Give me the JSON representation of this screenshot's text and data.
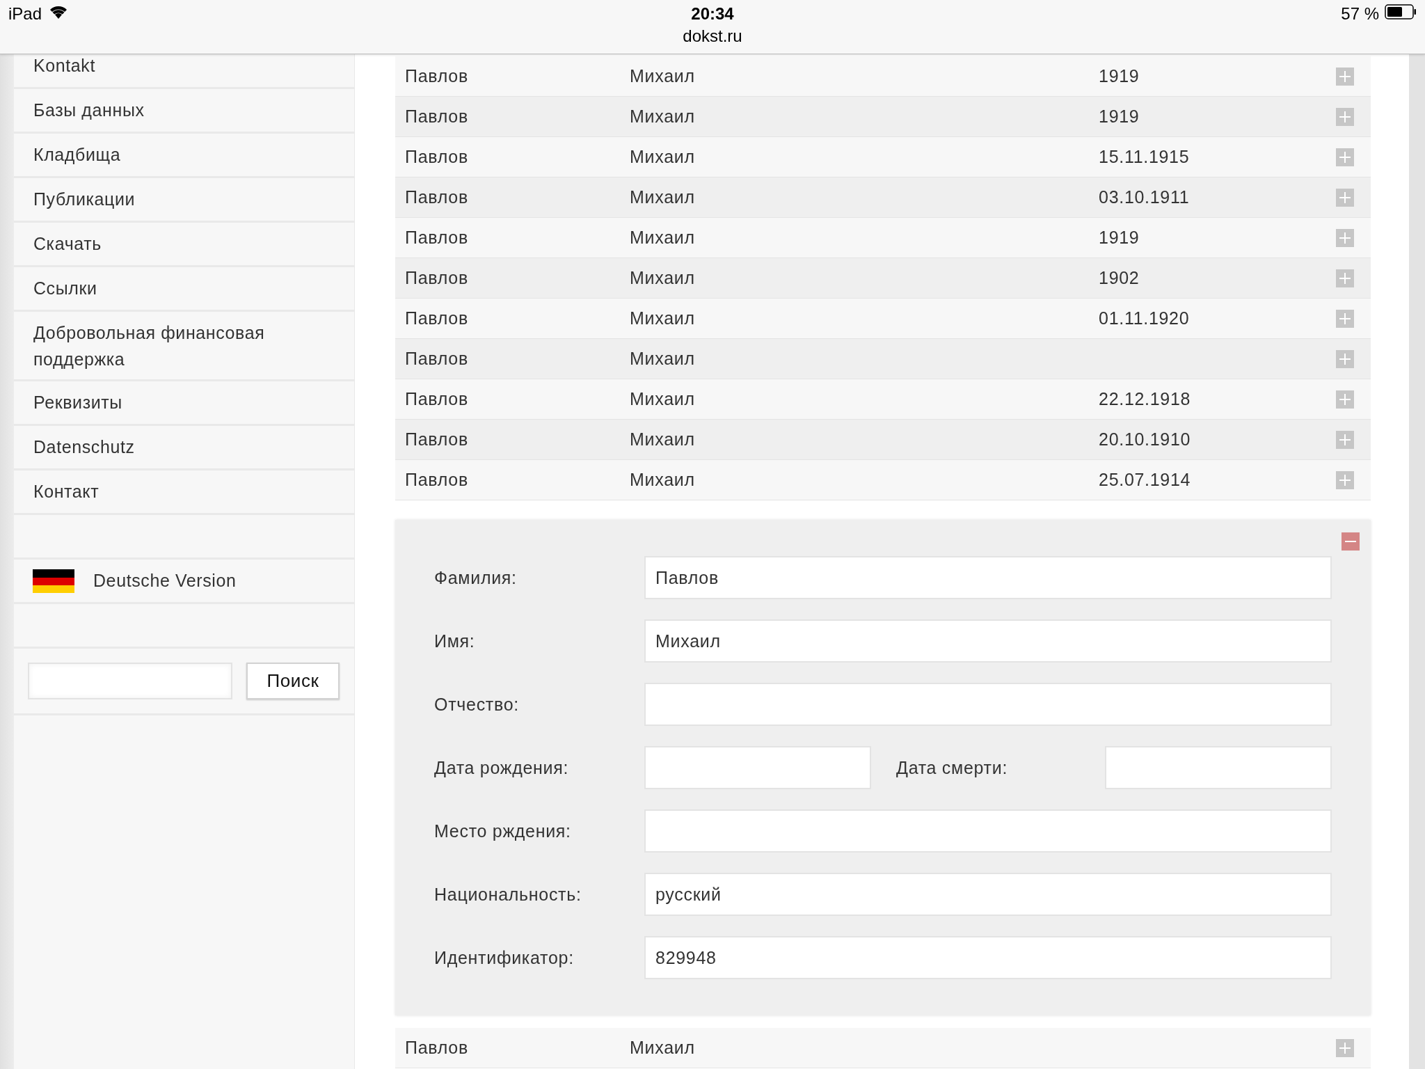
{
  "status_bar": {
    "device": "iPad",
    "time": "20:34",
    "url": "dokst.ru",
    "battery": "57 %"
  },
  "sidebar": {
    "items": [
      {
        "label": "Kontakt"
      },
      {
        "label": "Базы данных"
      },
      {
        "label": "Кладбища"
      },
      {
        "label": "Публикации"
      },
      {
        "label": "Скачать"
      },
      {
        "label": "Ссылки"
      },
      {
        "label": "Добровольная финансовая поддержка"
      },
      {
        "label": "Реквизиты"
      },
      {
        "label": "Datenschutz"
      },
      {
        "label": "Контакт"
      }
    ],
    "language_link": {
      "label": "Deutsche Version"
    },
    "search": {
      "button": "Поиск"
    }
  },
  "table": {
    "rows": [
      {
        "surname": "Павлов",
        "name": "Михаил",
        "date": "1919",
        "expanded": false
      },
      {
        "surname": "Павлов",
        "name": "Михаил",
        "date": "1919",
        "expanded": false
      },
      {
        "surname": "Павлов",
        "name": "Михаил",
        "date": "15.11.1915",
        "expanded": false
      },
      {
        "surname": "Павлов",
        "name": "Михаил",
        "date": "03.10.1911",
        "expanded": false
      },
      {
        "surname": "Павлов",
        "name": "Михаил",
        "date": "1919",
        "expanded": false
      },
      {
        "surname": "Павлов",
        "name": "Михаил",
        "date": "1902",
        "expanded": false
      },
      {
        "surname": "Павлов",
        "name": "Михаил",
        "date": "01.11.1920",
        "expanded": false
      },
      {
        "surname": "Павлов",
        "name": "Михаил",
        "expanded": false
      },
      {
        "surname": "Павлов",
        "name": "Михаил",
        "date": "22.12.1918",
        "expanded": false
      },
      {
        "surname": "Павлов",
        "name": "Михаил",
        "date": "20.10.1910",
        "expanded": false
      },
      {
        "surname": "Павлов",
        "name": "Михаил",
        "date": "25.07.1914",
        "expanded": false
      }
    ],
    "detail": {
      "expanded": true,
      "rows": [
        {
          "fields": [
            {
              "label": "Фамилия:",
              "value": "Павлов"
            }
          ]
        },
        {
          "fields": [
            {
              "label": "Имя:",
              "value": "Михаил"
            }
          ]
        },
        {
          "fields": [
            {
              "label": "Отчество:"
            }
          ]
        },
        {
          "fields": [
            {
              "label": "Дата рождения:"
            },
            {
              "label": "Дата смерти:"
            }
          ]
        },
        {
          "fields": [
            {
              "label": "Место рждения:"
            }
          ]
        },
        {
          "fields": [
            {
              "label": "Национальность:",
              "value": "русский"
            }
          ]
        },
        {
          "fields": [
            {
              "label": "Идентификатор:",
              "value": "829948"
            }
          ]
        }
      ]
    },
    "rows_after": [
      {
        "surname": "Павлов",
        "name": "Михаил",
        "expanded": false
      }
    ]
  }
}
